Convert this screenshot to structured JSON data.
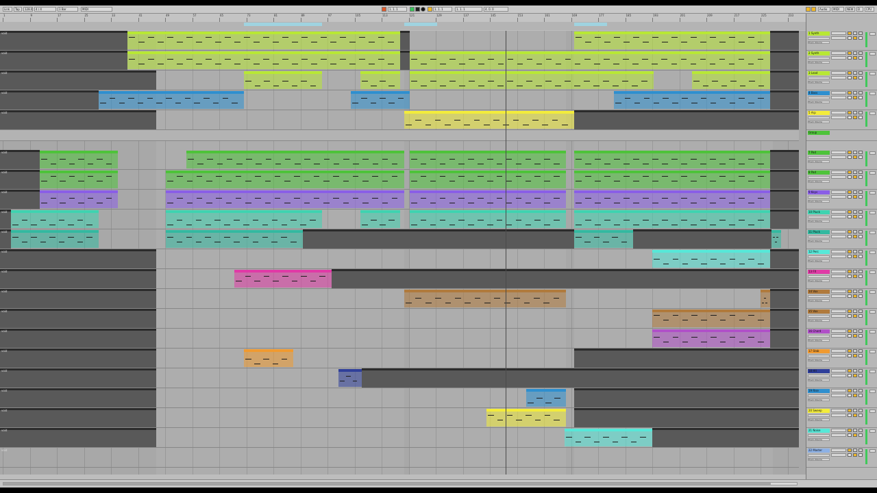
{
  "toolbar": {
    "left_items": [
      "Link",
      "Tap",
      "Hold",
      "4 / 4",
      "1 Bar",
      "Key",
      "MIDI"
    ],
    "bpm": "128.00",
    "position": "1. 1. 1",
    "loop_start": "1. 1. 1",
    "loop_length": "4. 0. 0",
    "right_items": [
      "Audio",
      "MIDI",
      "NEW",
      "D",
      "CPU"
    ]
  },
  "ruler": {
    "bar_labels": [
      "1",
      "9",
      "17",
      "25",
      "33",
      "41",
      "49",
      "57",
      "65",
      "73",
      "81",
      "89",
      "97",
      "105",
      "113",
      "121",
      "129",
      "137",
      "145",
      "153",
      "161",
      "169",
      "177",
      "185",
      "193",
      "201",
      "209",
      "217",
      "225",
      "233"
    ],
    "time_labels": [
      "0:00",
      "0:15",
      "0:30",
      "0:45",
      "1:00",
      "1:15",
      "1:30",
      "1:45",
      "2:00",
      "2:15",
      "2:30",
      "2:45",
      "3:00",
      "3:15",
      "3:30",
      "3:45",
      "4:00",
      "4:15",
      "4:30",
      "4:45",
      "5:00",
      "5:15",
      "5:30",
      "5:45",
      "6:00",
      "6:15",
      "6:30",
      "6:45",
      "7:00"
    ]
  },
  "colors": {
    "lime": "#b8e834",
    "green": "#4ec33a",
    "purple": "#8a5ee6",
    "teal": "#3fd3b0",
    "teal_dark": "#33b9a0",
    "blue": "#2e8fcf",
    "yellow": "#f3ec3a",
    "magenta": "#e03aa6",
    "brown": "#b07a3c",
    "violet": "#b050c8",
    "orange": "#f09a30",
    "navy": "#2f3f9a",
    "cyan": "#56e8d8",
    "loc": "#8db1e6",
    "red": "#d33838"
  },
  "tracks": [
    {
      "name": "1 Synth",
      "label": "void",
      "color": "lime"
    },
    {
      "name": "2 Synth",
      "label": "void",
      "color": "lime"
    },
    {
      "name": "3 Lead",
      "label": "void",
      "color": "lime"
    },
    {
      "name": "4 Bass",
      "label": "void",
      "color": "blue"
    },
    {
      "name": "5 Arp",
      "label": "void",
      "color": "yellow"
    },
    {
      "name": "Group",
      "label": "",
      "color": "green"
    },
    {
      "name": "7 Pad",
      "label": "void",
      "color": "green"
    },
    {
      "name": "8 Pad",
      "label": "void",
      "color": "green"
    },
    {
      "name": "9 Keys",
      "label": "void",
      "color": "purple"
    },
    {
      "name": "10 Pluck",
      "label": "void",
      "color": "teal"
    },
    {
      "name": "11 Pluck",
      "label": "void",
      "color": "teal_dark"
    },
    {
      "name": "12 Perc",
      "label": "void",
      "color": "cyan"
    },
    {
      "name": "13 FX",
      "label": "void",
      "color": "magenta"
    },
    {
      "name": "14 Vox",
      "label": "void",
      "color": "brown"
    },
    {
      "name": "15 Vox",
      "label": "void",
      "color": "brown"
    },
    {
      "name": "16 Chord",
      "label": "void",
      "color": "violet"
    },
    {
      "name": "17 Stab",
      "label": "void",
      "color": "orange"
    },
    {
      "name": "18 Hit",
      "label": "void",
      "color": "navy"
    },
    {
      "name": "19 Rise",
      "label": "void",
      "color": "blue"
    },
    {
      "name": "20 Sweep",
      "label": "void",
      "color": "yellow"
    },
    {
      "name": "21 Noise",
      "label": "void",
      "color": "cyan"
    },
    {
      "name": "22 Master",
      "label": "void",
      "color": "loc"
    }
  ],
  "locators": [
    "INTRO Breakdown 01",
    "BREAKDOWN FX01 Subsynth",
    "BUILD FX01 Drums 03"
  ],
  "mixer": {
    "device_label": "Track Volume",
    "send_label": "Sends",
    "volume": "0"
  }
}
